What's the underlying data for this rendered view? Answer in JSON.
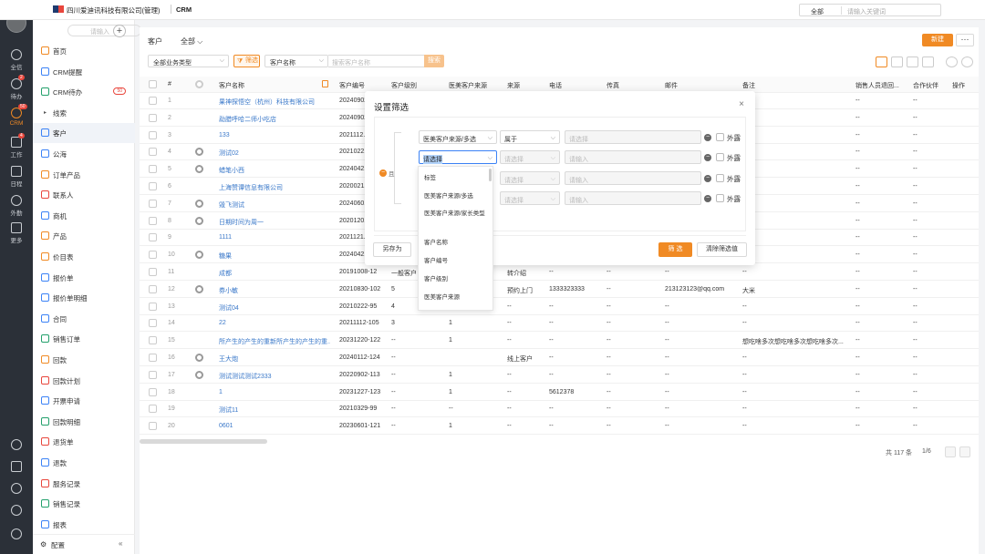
{
  "topbar": {
    "company": "四川爱迪讯科技有限公司(管理)",
    "module": "CRM",
    "search_scope": "全部",
    "search_placeholder": "请输入关键词"
  },
  "rail": {
    "items": [
      {
        "label": "全信",
        "badge": ""
      },
      {
        "label": "待办",
        "badge": "2"
      },
      {
        "label": "CRM",
        "badge": "50"
      },
      {
        "label": "工作",
        "badge": "4"
      },
      {
        "label": "日程",
        "badge": ""
      },
      {
        "label": "外勤",
        "badge": ""
      },
      {
        "label": "更多",
        "badge": ""
      }
    ]
  },
  "sidebar": {
    "search_placeholder": "请输入",
    "add": "+",
    "items": [
      {
        "label": "首页",
        "badge": ""
      },
      {
        "label": "CRM提醒",
        "badge": ""
      },
      {
        "label": "CRM待办",
        "badge": "50"
      },
      {
        "label": "线索",
        "badge": ""
      },
      {
        "label": "客户",
        "badge": ""
      },
      {
        "label": "公海",
        "badge": ""
      },
      {
        "label": "订单产品",
        "badge": ""
      },
      {
        "label": "联系人",
        "badge": ""
      },
      {
        "label": "商机",
        "badge": ""
      },
      {
        "label": "产品",
        "badge": ""
      },
      {
        "label": "价目表",
        "badge": ""
      },
      {
        "label": "报价单",
        "badge": ""
      },
      {
        "label": "报价单明细",
        "badge": ""
      },
      {
        "label": "合同",
        "badge": ""
      },
      {
        "label": "销售订单",
        "badge": ""
      },
      {
        "label": "回款",
        "badge": ""
      },
      {
        "label": "回款计划",
        "badge": ""
      },
      {
        "label": "开票申请",
        "badge": ""
      },
      {
        "label": "回款明细",
        "badge": ""
      },
      {
        "label": "退货单",
        "badge": ""
      },
      {
        "label": "退款",
        "badge": ""
      },
      {
        "label": "服务记录",
        "badge": ""
      },
      {
        "label": "销售记录",
        "badge": ""
      },
      {
        "label": "报表",
        "badge": ""
      }
    ],
    "footer": "配置",
    "collapse": "«"
  },
  "main": {
    "breadcrumb": "客户",
    "view": "全部",
    "new_button": "新建",
    "more_button": "···",
    "filter": {
      "biz_type": "全部业务类型",
      "filter_btn": "筛选",
      "field": "客户名称",
      "placeholder": "搜索客户名称",
      "search_btn": "搜索"
    },
    "columns": [
      "#",
      "客户名称",
      "客户编号",
      "客户级别",
      "医美客户来源",
      "来源",
      "电话",
      "传真",
      "邮件",
      "备注",
      "销售人员退回...",
      "合作伙伴",
      "操作"
    ],
    "rows": [
      {
        "n": "1",
        "name": "果神探悟空（杭州）科技有限公司",
        "code": "20240902-...",
        "level": "",
        "src": "",
        "from": "",
        "tel": "",
        "fax": "",
        "mail": "",
        "note": "",
        "ret": "--",
        "partner": "--",
        "eye": false
      },
      {
        "n": "2",
        "name": "勐腊呼哈二师小吃店",
        "code": "20240902-...",
        "level": "",
        "src": "",
        "from": "",
        "tel": "",
        "fax": "",
        "mail": "",
        "note": "",
        "ret": "--",
        "partner": "--",
        "eye": false
      },
      {
        "n": "3",
        "name": "133",
        "code": "2021112...",
        "level": "",
        "src": "",
        "from": "",
        "tel": "",
        "fax": "",
        "mail": "",
        "note": "",
        "ret": "--",
        "partner": "--",
        "eye": false
      },
      {
        "n": "4",
        "name": "测试02",
        "code": "2021022...",
        "level": "",
        "src": "",
        "from": "",
        "tel": "",
        "fax": "",
        "mail": "",
        "note": "",
        "ret": "--",
        "partner": "--",
        "eye": true
      },
      {
        "n": "5",
        "name": "蜡笔小西",
        "code": "2024042...",
        "level": "",
        "src": "",
        "from": "",
        "tel": "",
        "fax": "",
        "mail": "",
        "note": "",
        "ret": "--",
        "partner": "--",
        "eye": true
      },
      {
        "n": "6",
        "name": "上海赞谭信息有限公司",
        "code": "2020021...",
        "level": "",
        "src": "",
        "from": "",
        "tel": "",
        "fax": "",
        "mail": "",
        "note": "",
        "ret": "--",
        "partner": "--",
        "eye": false
      },
      {
        "n": "7",
        "name": "毁飞测试",
        "code": "2024060...",
        "level": "",
        "src": "",
        "from": "",
        "tel": "",
        "fax": "",
        "mail": "",
        "note": "",
        "ret": "--",
        "partner": "--",
        "eye": true
      },
      {
        "n": "8",
        "name": "日期时间为周一",
        "code": "2020120...",
        "level": "",
        "src": "",
        "from": "",
        "tel": "",
        "fax": "",
        "mail": "",
        "note": "",
        "ret": "--",
        "partner": "--",
        "eye": true
      },
      {
        "n": "9",
        "name": "1111",
        "code": "2021121...",
        "level": "",
        "src": "",
        "from": "",
        "tel": "",
        "fax": "",
        "mail": "",
        "note": "",
        "ret": "--",
        "partner": "--",
        "eye": false
      },
      {
        "n": "10",
        "name": "糖果",
        "code": "2024042...",
        "level": "",
        "src": "",
        "from": "",
        "tel": "",
        "fax": "",
        "mail": "",
        "note": "",
        "ret": "--",
        "partner": "--",
        "eye": true
      },
      {
        "n": "11",
        "name": "成都",
        "code": "20191008-12",
        "level": "一般客户",
        "src": "",
        "from": "转介绍",
        "tel": "--",
        "fax": "--",
        "mail": "--",
        "note": "--",
        "ret": "--",
        "partner": "--",
        "eye": false
      },
      {
        "n": "12",
        "name": "券小敏",
        "code": "20210830-102",
        "level": "5",
        "src": "",
        "from": "预约上门",
        "tel": "1333323333",
        "fax": "--",
        "mail": "213123123@qq.com",
        "note": "大米",
        "ret": "--",
        "partner": "--",
        "eye": true
      },
      {
        "n": "13",
        "name": "测试04",
        "code": "20210222-95",
        "level": "4",
        "src": "",
        "from": "--",
        "tel": "--",
        "fax": "--",
        "mail": "--",
        "note": "--",
        "ret": "--",
        "partner": "--",
        "eye": false
      },
      {
        "n": "14",
        "name": "22",
        "code": "20211112-105",
        "level": "3",
        "src": "1",
        "from": "--",
        "tel": "--",
        "fax": "--",
        "mail": "--",
        "note": "--",
        "ret": "--",
        "partner": "--",
        "eye": false
      },
      {
        "n": "15",
        "name": "所产生的产生的重新所产生的产生的重...",
        "code": "20231220-122",
        "level": "--",
        "src": "1",
        "from": "--",
        "tel": "--",
        "fax": "--",
        "mail": "--",
        "note": "想吃啥多次想吃啥多次想吃啥多次...",
        "ret": "--",
        "partner": "--",
        "eye": false
      },
      {
        "n": "16",
        "name": "王大炮",
        "code": "20240112-124",
        "level": "--",
        "src": "",
        "from": "线上客户",
        "tel": "--",
        "fax": "--",
        "mail": "--",
        "note": "--",
        "ret": "--",
        "partner": "--",
        "eye": true
      },
      {
        "n": "17",
        "name": "测试测试测试2333",
        "code": "20220902-113",
        "level": "--",
        "src": "1",
        "from": "--",
        "tel": "--",
        "fax": "--",
        "mail": "--",
        "note": "--",
        "ret": "--",
        "partner": "--",
        "eye": true
      },
      {
        "n": "18",
        "name": "1",
        "code": "20231227-123",
        "level": "--",
        "src": "1",
        "from": "--",
        "tel": "5612378",
        "fax": "--",
        "mail": "--",
        "note": "--",
        "ret": "--",
        "partner": "--",
        "eye": false
      },
      {
        "n": "19",
        "name": "测试11",
        "code": "20210329-99",
        "level": "--",
        "src": "--",
        "from": "--",
        "tel": "--",
        "fax": "--",
        "mail": "--",
        "note": "--",
        "ret": "--",
        "partner": "--",
        "eye": false
      },
      {
        "n": "20",
        "name": "0601",
        "code": "20230601-121",
        "level": "--",
        "src": "1",
        "from": "--",
        "tel": "--",
        "fax": "--",
        "mail": "--",
        "note": "--",
        "ret": "--",
        "partner": "--",
        "eye": false
      }
    ],
    "pager": {
      "total": "共 117 条",
      "page": "1/6"
    }
  },
  "modal": {
    "title": "设置筛选",
    "close": "×",
    "conj": "且",
    "rows": [
      {
        "field": "医美客户来源/多选",
        "op": "属于",
        "value": "请选择",
        "ext": "外露"
      },
      {
        "field": "请选择",
        "op": "请选择",
        "value": "请输入",
        "ext": "外露"
      },
      {
        "field": "",
        "op": "请选择",
        "value": "请输入",
        "ext": "外露"
      },
      {
        "field": "",
        "op": "请选择",
        "value": "请输入",
        "ext": "外露"
      }
    ],
    "save_as": "另存为",
    "confirm": "筛 选",
    "clear": "清除筛选值"
  },
  "dropdown": [
    "标签",
    "医美客户来源/多选",
    "医美客户来源/家长类型",
    "客户名称",
    "客户编号",
    "客户级别",
    "医美客户来源"
  ]
}
